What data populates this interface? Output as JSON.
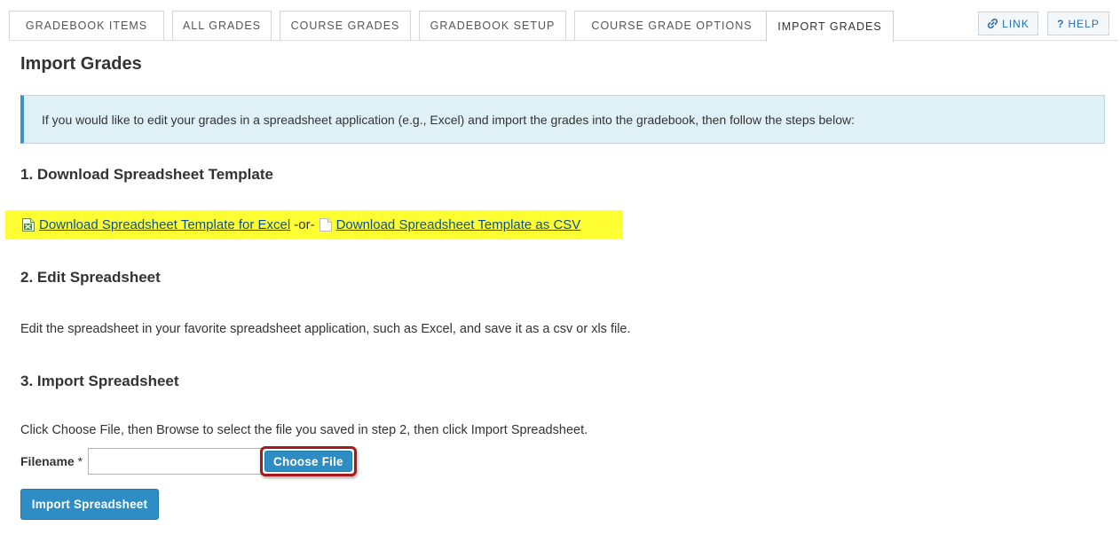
{
  "tabs": [
    {
      "label": "GRADEBOOK ITEMS",
      "active": false
    },
    {
      "label": "ALL GRADES",
      "active": false
    },
    {
      "label": "COURSE GRADES",
      "active": false
    },
    {
      "label": "GRADEBOOK SETUP",
      "active": false
    },
    {
      "label": "COURSE GRADE OPTIONS",
      "active": false
    },
    {
      "label": "IMPORT GRADES",
      "active": true
    }
  ],
  "tools": {
    "link_label": "LINK",
    "help_label": "HELP"
  },
  "page": {
    "title": "Import Grades",
    "info": "If you would like to edit your grades in a spreadsheet application (e.g., Excel) and import the grades into the gradebook, then follow the steps below:"
  },
  "step1": {
    "heading": "1. Download Spreadsheet Template",
    "excel_link": "Download Spreadsheet Template for Excel",
    "separator": "-or-",
    "csv_link": "Download Spreadsheet Template as CSV"
  },
  "step2": {
    "heading": "2. Edit Spreadsheet",
    "text": "Edit the spreadsheet in your favorite spreadsheet application, such as Excel, and save it as a csv or xls file."
  },
  "step3": {
    "heading": "3. Import Spreadsheet",
    "text": "Click Choose File, then Browse to select the file you saved in step 2, then click Import Spreadsheet.",
    "filename_label": "Filename",
    "required_marker": "*",
    "filename_value": "",
    "choose_label": "Choose File",
    "import_label": "Import Spreadsheet"
  },
  "colors": {
    "highlight": "#ffff33",
    "accent": "#2e8dc5",
    "callout": "#a51b1b"
  }
}
